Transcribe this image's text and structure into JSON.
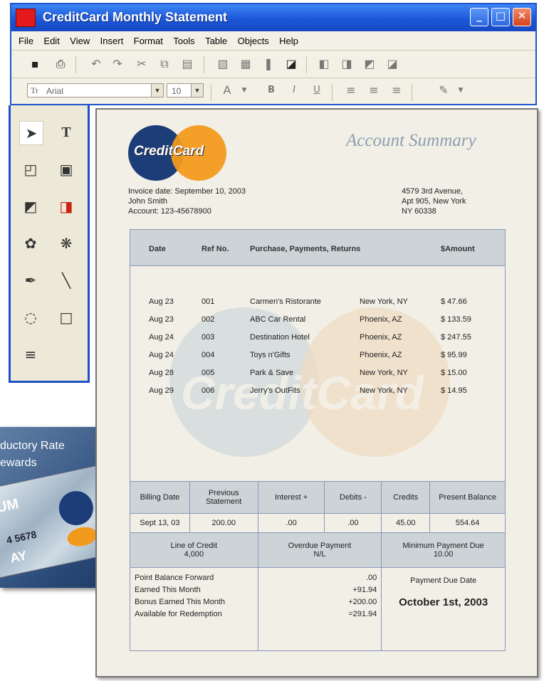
{
  "window": {
    "title": "CreditCard Monthly Statement"
  },
  "menu": [
    "File",
    "Edit",
    "View",
    "Insert",
    "Format",
    "Tools",
    "Table",
    "Objects",
    "Help"
  ],
  "toolbar": {
    "font_value": "Arial",
    "size_value": "10"
  },
  "promo": {
    "line1": "ductory Rate",
    "line2": "ewards",
    "card_text1": "UM",
    "card_text2": "4 5678",
    "card_text3": "AY"
  },
  "statement": {
    "account_summary": "Account Summary",
    "logo": "CreditCard",
    "invoice_date": "Invoice date: September 10, 2003",
    "name": "John Smith",
    "account": "Account: 123-45678900",
    "address1": "4579 3rd Avenue,",
    "address2": "Apt 905, New York",
    "address3": "NY 60338",
    "watermark": "CreditCard",
    "headers": {
      "date": "Date",
      "ref": "Ref No.",
      "purchase": "Purchase, Payments, Returns",
      "amount": "$Amount"
    },
    "transactions": [
      {
        "date": "Aug 23",
        "ref": "001",
        "desc": "Carmen's Ristorante",
        "loc": "New York, NY",
        "amount": "$ 47.66"
      },
      {
        "date": "Aug 23",
        "ref": "002",
        "desc": "ABC Car Rental",
        "loc": "Phoenix, AZ",
        "amount": "$ 133.59"
      },
      {
        "date": "Aug 24",
        "ref": "003",
        "desc": "Destination Hotel",
        "loc": "Phoenix, AZ",
        "amount": "$ 247.55"
      },
      {
        "date": "Aug 24",
        "ref": "004",
        "desc": "Toys n'Gifts",
        "loc": "Phoenix, AZ",
        "amount": "$ 95.99"
      },
      {
        "date": "Aug 28",
        "ref": "005",
        "desc": "Park & Save",
        "loc": "New York, NY",
        "amount": "$ 15.00"
      },
      {
        "date": "Aug 29",
        "ref": "006",
        "desc": "Jerry's OutFits",
        "loc": "New York, NY",
        "amount": "$ 14.95"
      }
    ],
    "summary_headers": [
      "Billing Date",
      "Previous Statement",
      "Interest +",
      "Debits -",
      "Credits",
      "Present Balance"
    ],
    "summary_values": [
      "Sept 13, 03",
      "200.00",
      ".00",
      ".00",
      "45.00",
      "554.64"
    ],
    "line_of_credit_label": "Line of Credit",
    "line_of_credit_value": "4,000",
    "overdue_label": "Overdue Payment",
    "overdue_value": "N/L",
    "min_due_label": "Minimum Payment Due",
    "min_due_value": "10.00",
    "points_labels": [
      "Point Balance Forward",
      "Earned This Month",
      "Bonus Earned This Month",
      "Available for Redemption"
    ],
    "points_values": [
      ".00",
      "+91.94",
      "+200.00",
      "=291.94"
    ],
    "payment_due_label": "Payment Due Date",
    "payment_due_value": "October 1st, 2003"
  }
}
